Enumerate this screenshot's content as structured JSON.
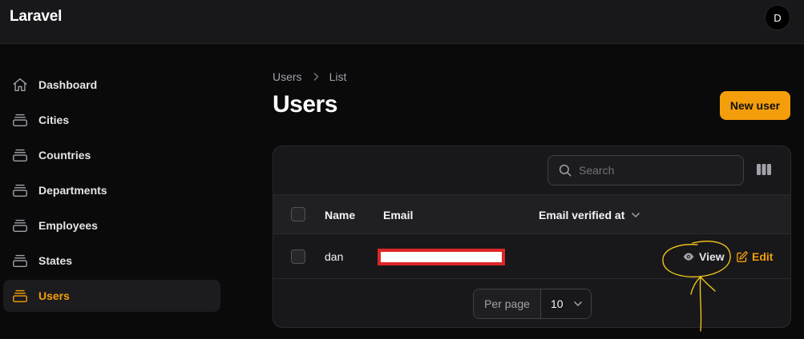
{
  "app": {
    "brand": "Laravel",
    "avatar_initial": "D"
  },
  "sidebar": {
    "items": [
      {
        "label": "Dashboard",
        "icon": "home-icon",
        "active": false
      },
      {
        "label": "Cities",
        "icon": "rectangle-stack-icon",
        "active": false
      },
      {
        "label": "Countries",
        "icon": "rectangle-stack-icon",
        "active": false
      },
      {
        "label": "Departments",
        "icon": "rectangle-stack-icon",
        "active": false
      },
      {
        "label": "Employees",
        "icon": "rectangle-stack-icon",
        "active": false
      },
      {
        "label": "States",
        "icon": "rectangle-stack-icon",
        "active": false
      },
      {
        "label": "Users",
        "icon": "rectangle-stack-icon",
        "active": true
      }
    ]
  },
  "breadcrumb": {
    "parent": "Users",
    "current": "List"
  },
  "page": {
    "title": "Users",
    "new_button": "New user"
  },
  "table": {
    "search_placeholder": "Search",
    "columns": [
      "Name",
      "Email",
      "Email verified at"
    ],
    "rows": [
      {
        "name": "dan",
        "email": "",
        "actions": [
          "View",
          "Edit"
        ]
      }
    ],
    "pagination": {
      "label": "Per page",
      "value": "10"
    }
  },
  "colors": {
    "accent": "#f59e0b",
    "annotation": "#facc15",
    "redaction": "#dc2626"
  }
}
